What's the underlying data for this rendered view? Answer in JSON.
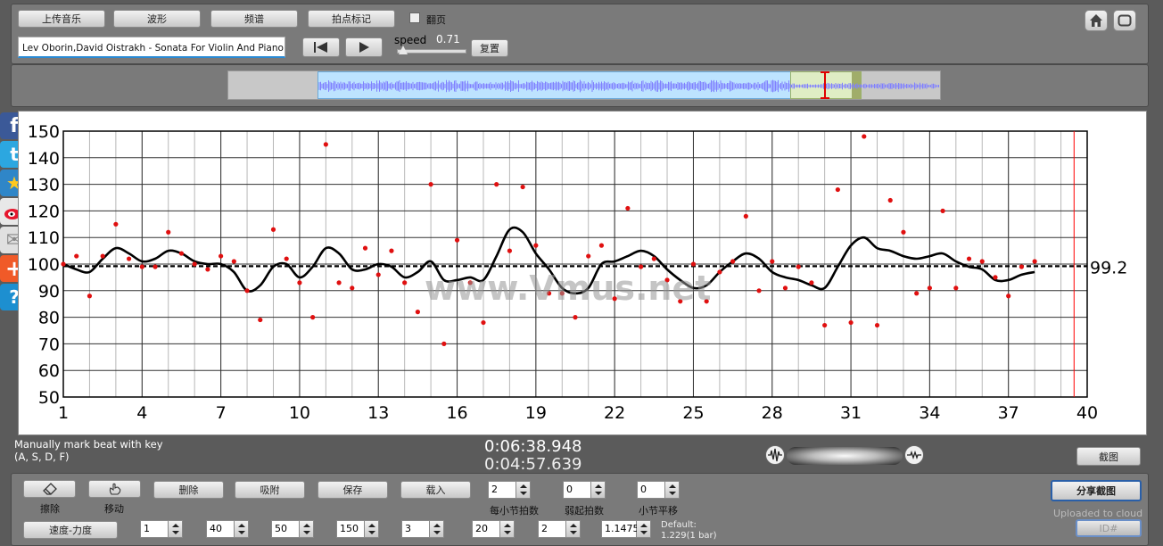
{
  "toolbar": {
    "upload_label": "上传音乐",
    "waveform_label": "波形",
    "spectrum_label": "频谱",
    "beat_mark_label": "拍点标记",
    "flip_label": "翻页",
    "track_title": "Lev Oborin,David Oistrakh - Sonata For Violin And Piano No.",
    "speed_label": "speed",
    "speed_value": "0.71",
    "reset_label": "复置"
  },
  "info": {
    "manual_line1": "Manually mark beat with key",
    "manual_line2": "(A, S, D, F)",
    "time_total": "0:06:38.948",
    "time_current": "0:04:57.639",
    "screenshot_label": "截图"
  },
  "bottom": {
    "erase_label": "擦除",
    "move_label": "移动",
    "delete_label": "删除",
    "snap_label": "吸附",
    "save_label": "保存",
    "load_label": "载入",
    "beats_per_bar_value": "2",
    "beats_per_bar_label": "每小节拍数",
    "pickup_value": "0",
    "pickup_label": "弱起拍数",
    "bar_shift_value": "0",
    "bar_shift_label": "小节平移",
    "share_label": "分享截图",
    "uploaded_label": "Uploaded to cloud",
    "id_label": "ID#",
    "tempo_dynamics_label": "速度-力度",
    "spinner_values": [
      "1",
      "40",
      "50",
      "150",
      "3",
      "20",
      "2",
      "1.1475"
    ],
    "default_label": "Default:",
    "default_value": "1.229(1 bar)"
  },
  "watermark": "www.Vmus.net",
  "social": [
    "f",
    "t",
    "★",
    "✉",
    "+",
    "?"
  ],
  "colors": {
    "points": "#e01010",
    "curve": "#000000",
    "waveform": "#8080ff",
    "selection": "#bde3ff",
    "cursor": "#ff0000"
  },
  "chart_data": {
    "type": "scatter",
    "xlim": [
      1,
      40
    ],
    "ylim": [
      50,
      150
    ],
    "x_ticks": [
      1,
      4,
      7,
      10,
      13,
      16,
      19,
      22,
      25,
      28,
      31,
      34,
      37,
      40
    ],
    "y_ticks": [
      50,
      60,
      70,
      80,
      90,
      100,
      110,
      120,
      130,
      140,
      150
    ],
    "reference_line": 99.2,
    "reference_label": "99.2",
    "cursor_x": 39.5,
    "grid": true,
    "points": [
      [
        1,
        100
      ],
      [
        1.5,
        103
      ],
      [
        2,
        88
      ],
      [
        2.5,
        103
      ],
      [
        3,
        115
      ],
      [
        3.5,
        102
      ],
      [
        4,
        99
      ],
      [
        4.5,
        99
      ],
      [
        5,
        112
      ],
      [
        5.5,
        104
      ],
      [
        6,
        100
      ],
      [
        6.5,
        98
      ],
      [
        7,
        103
      ],
      [
        7.5,
        101
      ],
      [
        8,
        90
      ],
      [
        8.5,
        79
      ],
      [
        9,
        113
      ],
      [
        9.5,
        102
      ],
      [
        10,
        93
      ],
      [
        10.5,
        80
      ],
      [
        11,
        145
      ],
      [
        11.5,
        93
      ],
      [
        12,
        91
      ],
      [
        12.5,
        106
      ],
      [
        13,
        96
      ],
      [
        13.5,
        105
      ],
      [
        14,
        93
      ],
      [
        14.5,
        82
      ],
      [
        15,
        130
      ],
      [
        15.5,
        70
      ],
      [
        16,
        109
      ],
      [
        16.5,
        93
      ],
      [
        17,
        78
      ],
      [
        17.5,
        130
      ],
      [
        18,
        105
      ],
      [
        18.5,
        129
      ],
      [
        19,
        107
      ],
      [
        19.5,
        89
      ],
      [
        20,
        89
      ],
      [
        20.5,
        80
      ],
      [
        21,
        103
      ],
      [
        21.5,
        107
      ],
      [
        22,
        87
      ],
      [
        22.5,
        121
      ],
      [
        23,
        99
      ],
      [
        23.5,
        102
      ],
      [
        24,
        94
      ],
      [
        24.5,
        86
      ],
      [
        25,
        100
      ],
      [
        25.5,
        86
      ],
      [
        26,
        97
      ],
      [
        26.5,
        101
      ],
      [
        27,
        118
      ],
      [
        27.5,
        90
      ],
      [
        28,
        101
      ],
      [
        28.5,
        91
      ],
      [
        29,
        99
      ],
      [
        29.5,
        93
      ],
      [
        30,
        77
      ],
      [
        30.5,
        128
      ],
      [
        31,
        78
      ],
      [
        31.5,
        148
      ],
      [
        32,
        77
      ],
      [
        32.5,
        124
      ],
      [
        33,
        112
      ],
      [
        33.5,
        89
      ],
      [
        34,
        91
      ],
      [
        34.5,
        120
      ],
      [
        35,
        91
      ],
      [
        35.5,
        102
      ],
      [
        36,
        101
      ],
      [
        36.5,
        95
      ],
      [
        37,
        88
      ],
      [
        37.5,
        99
      ],
      [
        38,
        101
      ]
    ],
    "curve": [
      [
        1,
        100
      ],
      [
        1.5,
        98
      ],
      [
        2,
        97
      ],
      [
        2.5,
        102
      ],
      [
        3,
        106
      ],
      [
        3.5,
        104
      ],
      [
        4,
        101
      ],
      [
        4.5,
        102
      ],
      [
        5,
        105
      ],
      [
        5.5,
        104
      ],
      [
        6,
        101
      ],
      [
        6.5,
        100
      ],
      [
        7,
        100
      ],
      [
        7.5,
        97
      ],
      [
        8,
        90
      ],
      [
        8.5,
        92
      ],
      [
        9,
        99
      ],
      [
        9.5,
        100
      ],
      [
        10,
        95
      ],
      [
        10.5,
        99
      ],
      [
        11,
        106
      ],
      [
        11.5,
        104
      ],
      [
        12,
        98
      ],
      [
        12.5,
        98
      ],
      [
        13,
        100
      ],
      [
        13.5,
        99
      ],
      [
        14,
        95
      ],
      [
        14.5,
        97
      ],
      [
        15,
        101
      ],
      [
        15.5,
        94
      ],
      [
        16,
        94
      ],
      [
        16.5,
        95
      ],
      [
        17,
        94
      ],
      [
        17.5,
        103
      ],
      [
        18,
        113
      ],
      [
        18.5,
        112
      ],
      [
        19,
        104
      ],
      [
        19.5,
        98
      ],
      [
        20,
        91
      ],
      [
        20.5,
        89
      ],
      [
        21,
        91
      ],
      [
        21.5,
        100
      ],
      [
        22,
        101
      ],
      [
        22.5,
        103
      ],
      [
        23,
        105
      ],
      [
        23.5,
        103
      ],
      [
        24,
        98
      ],
      [
        24.5,
        94
      ],
      [
        25,
        91
      ],
      [
        25.5,
        92
      ],
      [
        26,
        97
      ],
      [
        26.5,
        101
      ],
      [
        27,
        104
      ],
      [
        27.5,
        102
      ],
      [
        28,
        97
      ],
      [
        28.5,
        95
      ],
      [
        29,
        94
      ],
      [
        29.5,
        92
      ],
      [
        30,
        91
      ],
      [
        30.5,
        99
      ],
      [
        31,
        107
      ],
      [
        31.5,
        110
      ],
      [
        32,
        106
      ],
      [
        32.5,
        105
      ],
      [
        33,
        103
      ],
      [
        33.5,
        102
      ],
      [
        34,
        103
      ],
      [
        34.5,
        104
      ],
      [
        35,
        101
      ],
      [
        35.5,
        99
      ],
      [
        36,
        98
      ],
      [
        36.5,
        94
      ],
      [
        37,
        94
      ],
      [
        37.5,
        96
      ],
      [
        38,
        97
      ]
    ]
  }
}
